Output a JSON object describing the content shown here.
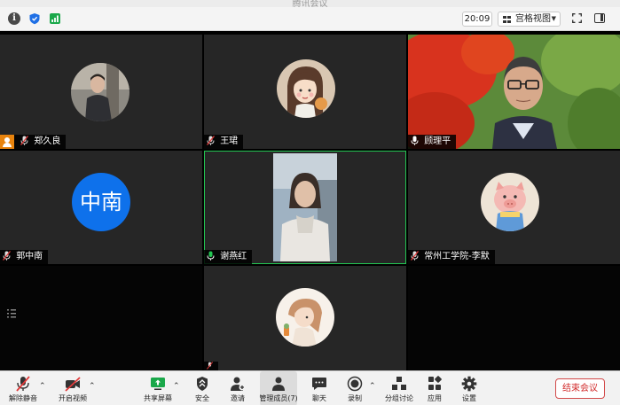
{
  "window": {
    "title": "腾讯会议"
  },
  "topbar": {
    "timer": "20:09",
    "view_mode": "宫格视图"
  },
  "participants": [
    {
      "name": "郑久良",
      "role": "host"
    },
    {
      "name": "王珺"
    },
    {
      "name": "顾理平"
    },
    {
      "name": "郭中南",
      "avatar_text": "中南"
    },
    {
      "name": "谢燕红",
      "active_speaker": true
    },
    {
      "name": "常州工学院-李默"
    },
    {
      "name": ""
    }
  ],
  "controls": {
    "unmute": "解除静音",
    "start_video": "开启视频",
    "share_screen": "共享屏幕",
    "security": "安全",
    "invite": "邀请",
    "manage_members": "管理成员(7)",
    "chat": "聊天",
    "record": "录制",
    "breakout": "分组讨论",
    "apps": "应用",
    "settings": "设置",
    "end_meeting": "结束会议"
  },
  "colors": {
    "active_speaker_border": "#23c552",
    "host_badge": "#e8830d",
    "end_button": "#d12a2a",
    "avatar_blue": "#0e71eb"
  }
}
